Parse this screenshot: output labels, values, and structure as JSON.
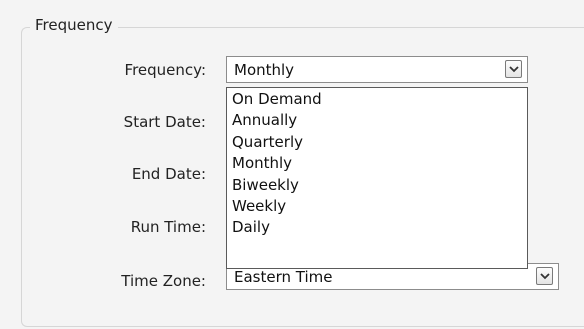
{
  "group": {
    "legend": "Frequency"
  },
  "fields": {
    "frequency": {
      "label": "Frequency:",
      "value": "Monthly"
    },
    "start_date": {
      "label": "Start Date:"
    },
    "end_date": {
      "label": "End Date:"
    },
    "run_time": {
      "label": "Run Time:"
    },
    "time_zone": {
      "label": "Time Zone:",
      "value": "Eastern Time"
    }
  },
  "frequency_options": [
    "On Demand",
    "Annually",
    "Quarterly",
    "Monthly",
    "Biweekly",
    "Weekly",
    "Daily"
  ],
  "icons": {
    "dropdown": "chevron-down-icon"
  }
}
